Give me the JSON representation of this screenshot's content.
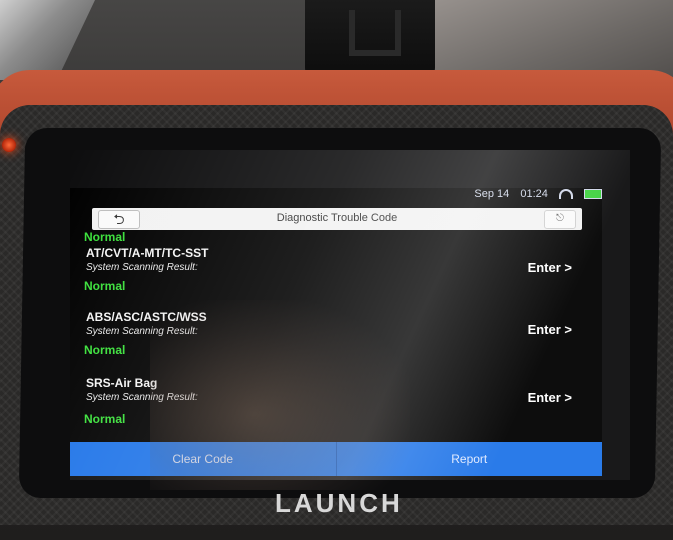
{
  "device": {
    "brand": "LAUNCH"
  },
  "status_bar": {
    "date": "Sep 14",
    "time": "01:24"
  },
  "header": {
    "back_symbol": "⮌",
    "title": "Diagnostic Trouble Code",
    "exit_symbol": "⎋"
  },
  "systems": [
    {
      "status_above": "Normal"
    },
    {
      "name": "AT/CVT/A-MT/TC-SST",
      "scan_label": "System Scanning Result:",
      "status": "Normal",
      "enter_label": "Enter >"
    },
    {
      "name": "ABS/ASC/ASTC/WSS",
      "scan_label": "System Scanning Result:",
      "status": "Normal",
      "enter_label": "Enter >"
    },
    {
      "name": "SRS-Air Bag",
      "scan_label": "System Scanning Result:",
      "status": "Normal",
      "enter_label": "Enter >"
    }
  ],
  "footer": {
    "clear_code_label": "Clear Code",
    "report_label": "Report"
  },
  "colors": {
    "status_normal": "#39e039",
    "footer_bar": "#1f74e8",
    "device_orange": "#c75a3c"
  }
}
